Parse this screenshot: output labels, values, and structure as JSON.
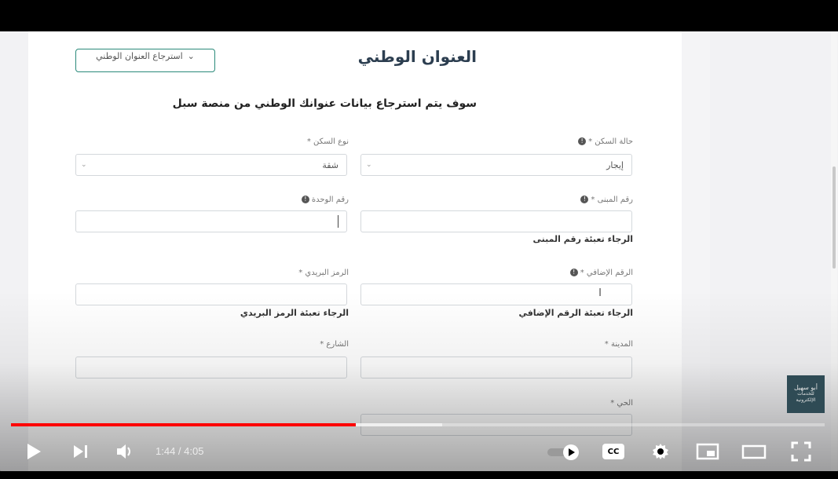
{
  "form": {
    "section_title": "العنوان الوطني",
    "retrieve_button": "استرجاع العنوان الوطني",
    "subtitle": "سوف يتم استرجاع بيانات عنوانك الوطني من منصة سبل",
    "housing_status": {
      "label": "حالة السكن *",
      "value": "إيجار"
    },
    "housing_type": {
      "label": "نوع السكن *",
      "value": "شقة"
    },
    "building_number": {
      "label": "رقم المبنى *",
      "value": "",
      "error": "الرجاء تعبئة رقم المبنى"
    },
    "unit_number": {
      "label": "رقم الوحدة",
      "value": ""
    },
    "additional_number": {
      "label": "الرقم الإضافي *",
      "value": "",
      "error": "الرجاء تعبئة الرقم الإضافي"
    },
    "postal_code": {
      "label": "الرمز البريدي *",
      "value": "",
      "error": "الرجاء تعبئة الرمز البريدي"
    },
    "city": {
      "label": "المدينة *",
      "value": ""
    },
    "street": {
      "label": "الشارع *",
      "value": ""
    },
    "district": {
      "label": "الحي *",
      "value": ""
    }
  },
  "player": {
    "current_time": "1:44",
    "duration": "4:05",
    "time_display": "1:44 / 4:05",
    "played_fraction": 0.424,
    "buffered_fraction": 0.53,
    "icons": [
      "play-icon",
      "next-icon",
      "volume-icon",
      "autoplay-toggle-icon",
      "captions-icon",
      "settings-icon",
      "miniplayer-icon",
      "theater-mode-icon",
      "fullscreen-icon"
    ],
    "captions_label": "CC",
    "accent_color": "#ff0000"
  },
  "watermark": {
    "line1": "أبو سهيل",
    "line2": "للخدمات الإلكترونية"
  }
}
